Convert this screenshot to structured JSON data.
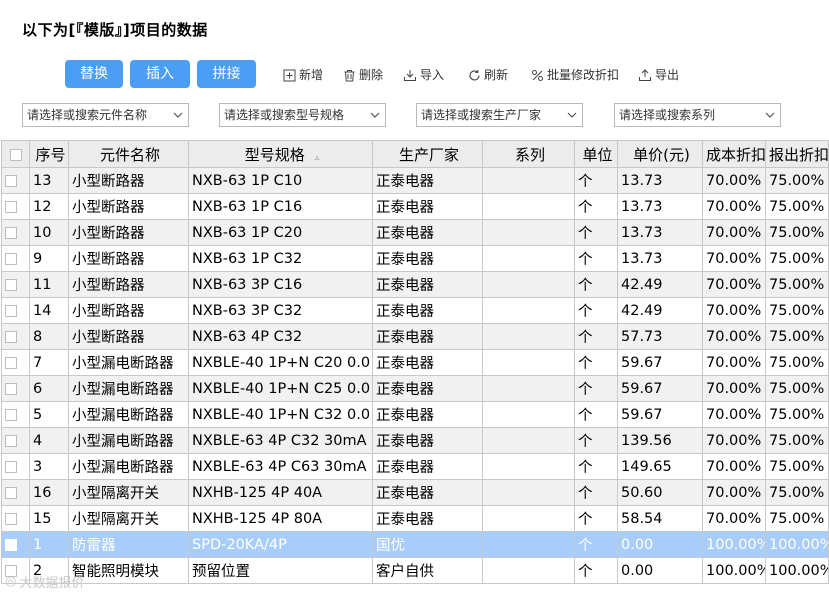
{
  "title": "以下为[『模版』]项目的数据",
  "buttons": {
    "replace": "替换",
    "insert": "插入",
    "concat": "拼接"
  },
  "toolbar": {
    "add": "新增",
    "delete": "删除",
    "import": "导入",
    "refresh": "刷新",
    "batch_edit": "批量修改折扣",
    "export": "导出"
  },
  "filters": {
    "name": "请选择或搜索元件名称",
    "model": "请选择或搜索型号规格",
    "maker": "请选择或搜索生产厂家",
    "series": "请选择或搜索系列"
  },
  "columns": [
    "序号",
    "元件名称",
    "型号规格",
    "生产厂家",
    "系列",
    "单位",
    "单价(元)",
    "成本折扣",
    "报出折扣"
  ],
  "rows": [
    {
      "no": "13",
      "name": "小型断路器",
      "model": "NXB-63 1P C10",
      "maker": "正泰电器",
      "series": "",
      "unit": "个",
      "price": "13.73",
      "cost": "70.00%",
      "quote": "75.00%"
    },
    {
      "no": "12",
      "name": "小型断路器",
      "model": "NXB-63 1P C16",
      "maker": "正泰电器",
      "series": "",
      "unit": "个",
      "price": "13.73",
      "cost": "70.00%",
      "quote": "75.00%"
    },
    {
      "no": "10",
      "name": "小型断路器",
      "model": "NXB-63 1P C20",
      "maker": "正泰电器",
      "series": "",
      "unit": "个",
      "price": "13.73",
      "cost": "70.00%",
      "quote": "75.00%"
    },
    {
      "no": "9",
      "name": "小型断路器",
      "model": "NXB-63 1P C32",
      "maker": "正泰电器",
      "series": "",
      "unit": "个",
      "price": "13.73",
      "cost": "70.00%",
      "quote": "75.00%"
    },
    {
      "no": "11",
      "name": "小型断路器",
      "model": "NXB-63 3P C16",
      "maker": "正泰电器",
      "series": "",
      "unit": "个",
      "price": "42.49",
      "cost": "70.00%",
      "quote": "75.00%"
    },
    {
      "no": "14",
      "name": "小型断路器",
      "model": "NXB-63 3P C32",
      "maker": "正泰电器",
      "series": "",
      "unit": "个",
      "price": "42.49",
      "cost": "70.00%",
      "quote": "75.00%"
    },
    {
      "no": "8",
      "name": "小型断路器",
      "model": "NXB-63 4P C32",
      "maker": "正泰电器",
      "series": "",
      "unit": "个",
      "price": "57.73",
      "cost": "70.00%",
      "quote": "75.00%"
    },
    {
      "no": "7",
      "name": "小型漏电断路器",
      "model": "NXBLE-40 1P+N C20 0.0",
      "maker": "正泰电器",
      "series": "",
      "unit": "个",
      "price": "59.67",
      "cost": "70.00%",
      "quote": "75.00%"
    },
    {
      "no": "6",
      "name": "小型漏电断路器",
      "model": "NXBLE-40 1P+N C25 0.0",
      "maker": "正泰电器",
      "series": "",
      "unit": "个",
      "price": "59.67",
      "cost": "70.00%",
      "quote": "75.00%"
    },
    {
      "no": "5",
      "name": "小型漏电断路器",
      "model": "NXBLE-40 1P+N C32 0.0",
      "maker": "正泰电器",
      "series": "",
      "unit": "个",
      "price": "59.67",
      "cost": "70.00%",
      "quote": "75.00%"
    },
    {
      "no": "4",
      "name": "小型漏电断路器",
      "model": "NXBLE-63 4P C32 30mA",
      "maker": "正泰电器",
      "series": "",
      "unit": "个",
      "price": "139.56",
      "cost": "70.00%",
      "quote": "75.00%"
    },
    {
      "no": "3",
      "name": "小型漏电断路器",
      "model": "NXBLE-63 4P C63 30mA",
      "maker": "正泰电器",
      "series": "",
      "unit": "个",
      "price": "149.65",
      "cost": "70.00%",
      "quote": "75.00%"
    },
    {
      "no": "16",
      "name": "小型隔离开关",
      "model": "NXHB-125 4P 40A",
      "maker": "正泰电器",
      "series": "",
      "unit": "个",
      "price": "50.60",
      "cost": "70.00%",
      "quote": "75.00%"
    },
    {
      "no": "15",
      "name": "小型隔离开关",
      "model": "NXHB-125 4P 80A",
      "maker": "正泰电器",
      "series": "",
      "unit": "个",
      "price": "58.54",
      "cost": "70.00%",
      "quote": "75.00%"
    },
    {
      "no": "1",
      "name": "防雷器",
      "model": "SPD-20KA/4P",
      "maker": "国优",
      "series": "",
      "unit": "个",
      "price": "0.00",
      "cost": "100.00%",
      "quote": "100.00%",
      "selected": true
    },
    {
      "no": "2",
      "name": "智能照明模块",
      "model": "预留位置",
      "maker": "客户自供",
      "series": "",
      "unit": "个",
      "price": "0.00",
      "cost": "100.00%",
      "quote": "100.00%"
    }
  ],
  "watermark": "大数据报价",
  "colors": {
    "primary_button": "#4b9ef3",
    "selected_row": "#a8cdfa",
    "header_bg": "#ececec"
  }
}
